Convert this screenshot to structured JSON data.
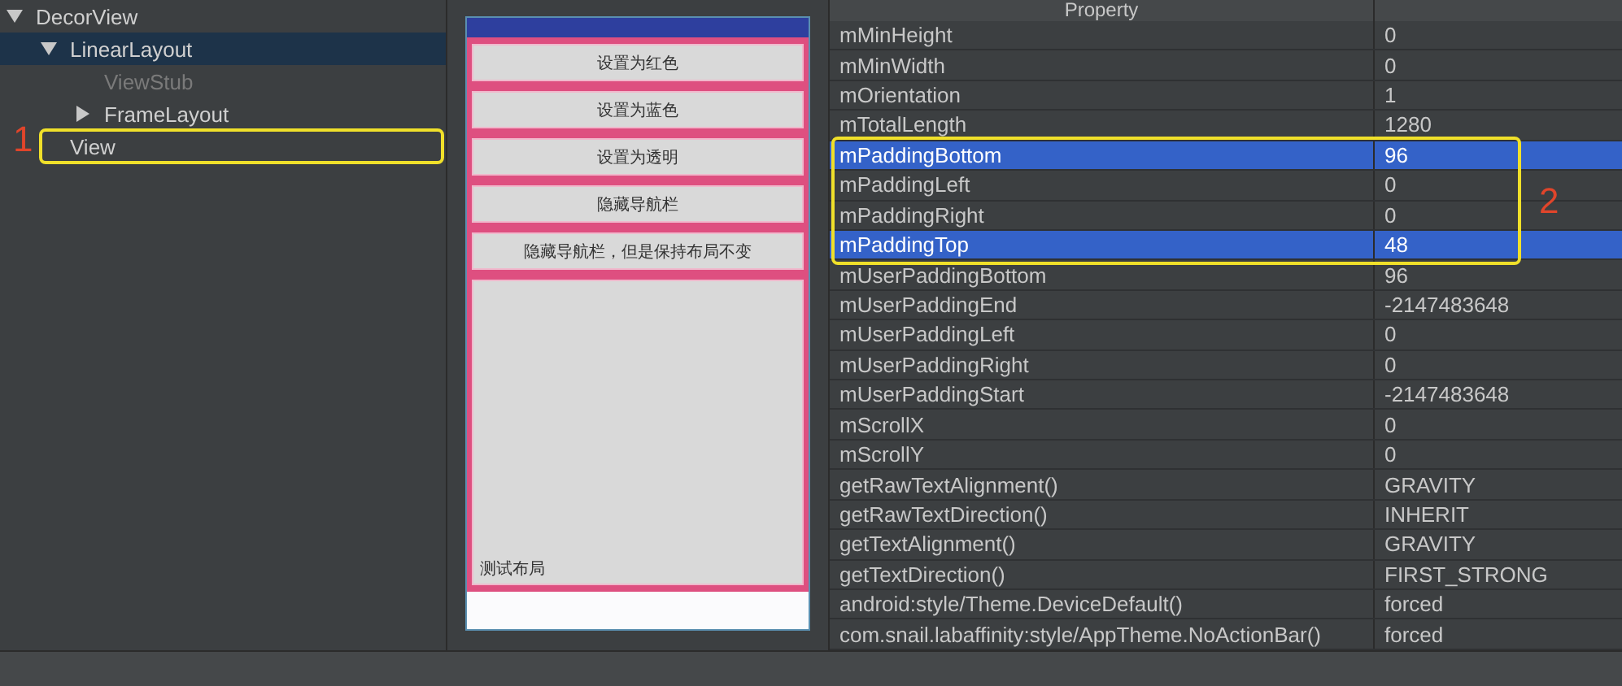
{
  "tree": [
    {
      "label": "DecorView",
      "expanded": true,
      "selected": false,
      "disabled": false,
      "outlined": false,
      "children": [
        {
          "label": "LinearLayout",
          "expanded": true,
          "selected": true,
          "disabled": false,
          "outlined": false,
          "children": [
            {
              "label": "ViewStub",
              "selected": false,
              "disabled": true,
              "outlined": false
            },
            {
              "label": "FrameLayout",
              "expanded": false,
              "selected": false,
              "disabled": false,
              "outlined": false
            }
          ]
        },
        {
          "label": "View",
          "selected": false,
          "disabled": false,
          "outlined": true
        }
      ]
    }
  ],
  "tree_marker": "1",
  "preview": {
    "buttons": [
      "设置为红色",
      "设置为蓝色",
      "设置为透明",
      "隐藏导航栏",
      "隐藏导航栏，但是保持布局不变"
    ],
    "content_label": "测试布局"
  },
  "properties": {
    "header": "Property",
    "marker": "2",
    "rows": [
      {
        "name": "mMinHeight",
        "value": "0",
        "selected": false,
        "outlined": false
      },
      {
        "name": "mMinWidth",
        "value": "0",
        "selected": false,
        "outlined": false
      },
      {
        "name": "mOrientation",
        "value": "1",
        "selected": false,
        "outlined": false
      },
      {
        "name": "mTotalLength",
        "value": "1280",
        "selected": false,
        "outlined": false
      },
      {
        "name": "mPaddingBottom",
        "value": "96",
        "selected": true,
        "outlined": true
      },
      {
        "name": "mPaddingLeft",
        "value": "0",
        "selected": false,
        "outlined": true
      },
      {
        "name": "mPaddingRight",
        "value": "0",
        "selected": false,
        "outlined": true
      },
      {
        "name": "mPaddingTop",
        "value": "48",
        "selected": true,
        "outlined": true
      },
      {
        "name": "mUserPaddingBottom",
        "value": "96",
        "selected": false,
        "outlined": false
      },
      {
        "name": "mUserPaddingEnd",
        "value": "-2147483648",
        "selected": false,
        "outlined": false
      },
      {
        "name": "mUserPaddingLeft",
        "value": "0",
        "selected": false,
        "outlined": false
      },
      {
        "name": "mUserPaddingRight",
        "value": "0",
        "selected": false,
        "outlined": false
      },
      {
        "name": "mUserPaddingStart",
        "value": "-2147483648",
        "selected": false,
        "outlined": false
      },
      {
        "name": "mScrollX",
        "value": "0",
        "selected": false,
        "outlined": false
      },
      {
        "name": "mScrollY",
        "value": "0",
        "selected": false,
        "outlined": false
      },
      {
        "name": "getRawTextAlignment()",
        "value": "GRAVITY",
        "selected": false,
        "outlined": false
      },
      {
        "name": "getRawTextDirection()",
        "value": "INHERIT",
        "selected": false,
        "outlined": false
      },
      {
        "name": "getTextAlignment()",
        "value": "GRAVITY",
        "selected": false,
        "outlined": false
      },
      {
        "name": "getTextDirection()",
        "value": "FIRST_STRONG",
        "selected": false,
        "outlined": false
      },
      {
        "name": "android:style/Theme.DeviceDefault()",
        "value": "forced",
        "selected": false,
        "outlined": false
      },
      {
        "name": "com.snail.labaffinity:style/AppTheme.NoActionBar()",
        "value": "forced",
        "selected": false,
        "outlined": false
      }
    ]
  }
}
